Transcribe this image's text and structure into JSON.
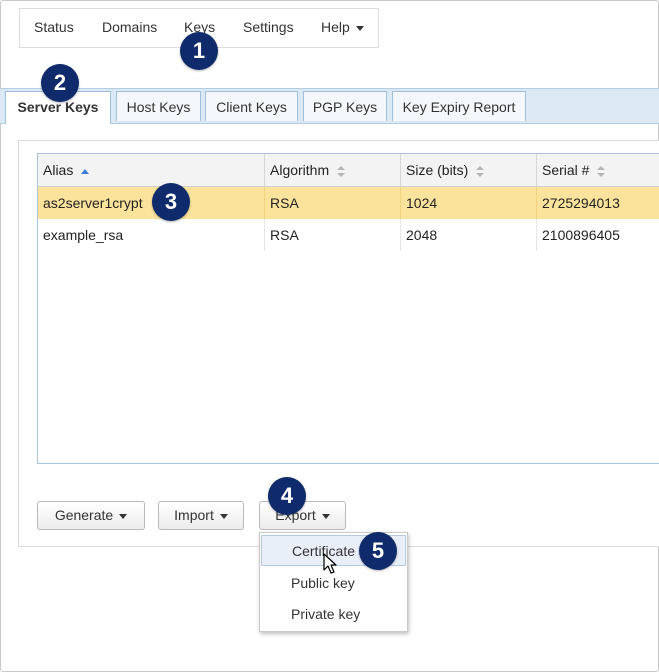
{
  "topnav": {
    "items": [
      {
        "label": "Status"
      },
      {
        "label": "Domains"
      },
      {
        "label": "Keys"
      },
      {
        "label": "Settings"
      },
      {
        "label": "Help",
        "icon": "caret-down-icon"
      }
    ]
  },
  "tabs": {
    "items": [
      {
        "label": "Server Keys",
        "active": true
      },
      {
        "label": "Host Keys"
      },
      {
        "label": "Client Keys"
      },
      {
        "label": "PGP Keys"
      },
      {
        "label": "Key Expiry Report"
      }
    ]
  },
  "table": {
    "columns": [
      {
        "label": "Alias",
        "sort": "ascending"
      },
      {
        "label": "Algorithm",
        "sort": "none"
      },
      {
        "label": "Size (bits)",
        "sort": "none"
      },
      {
        "label": "Serial #",
        "sort": "none"
      }
    ],
    "rows": [
      {
        "alias": "as2server1crypt",
        "algorithm": "RSA",
        "size": "1024",
        "serial": "2725294013",
        "selected": true
      },
      {
        "alias": "example_rsa",
        "algorithm": "RSA",
        "size": "2048",
        "serial": "2100896405",
        "selected": false
      }
    ]
  },
  "buttons": {
    "generate": "Generate",
    "import": "Import",
    "export": "Export"
  },
  "export_menu": {
    "items": [
      "Certificate",
      "Public key",
      "Private key"
    ],
    "hovered": "Certificate"
  },
  "callouts": [
    "1",
    "2",
    "3",
    "4",
    "5"
  ],
  "colors": {
    "selected_row": "#fce39b",
    "tabbar": "#dbe9f5",
    "callout": "#0f2b6b",
    "sort_active": "#3a7bd5"
  }
}
